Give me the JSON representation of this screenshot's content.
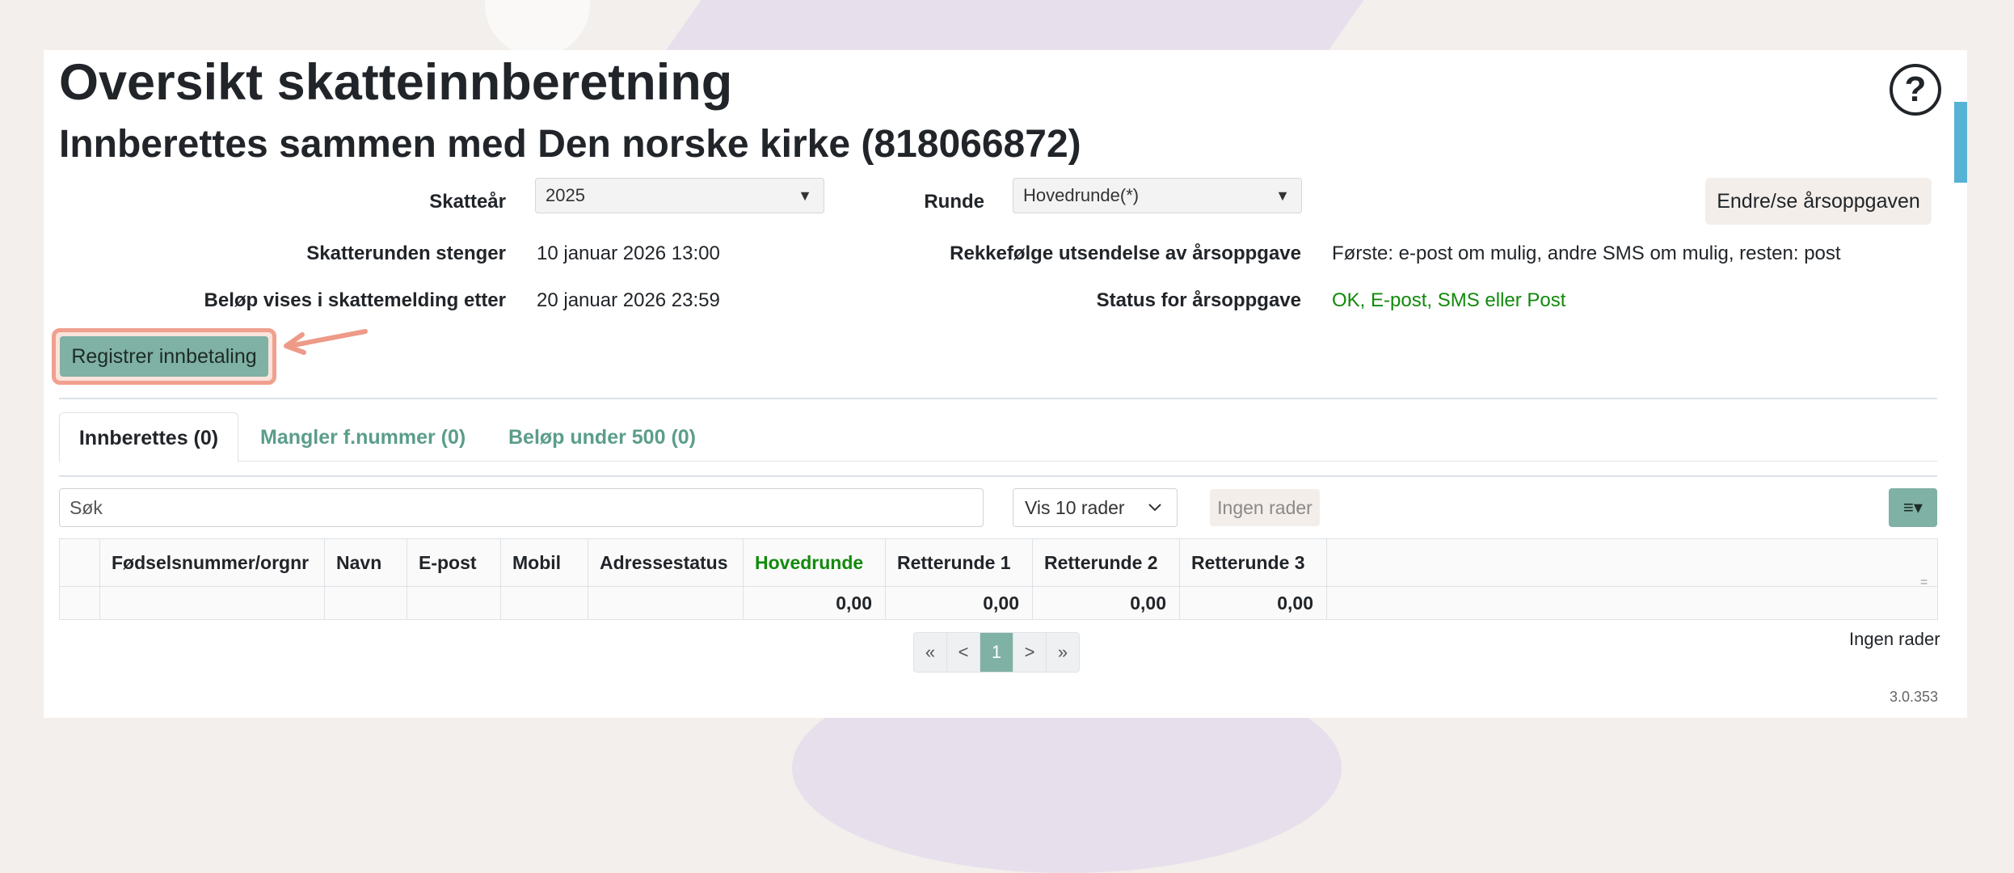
{
  "header": {
    "title": "Oversikt skatteinnberetning",
    "subtitle": "Innberettes sammen med Den norske kirke (818066872)",
    "help_symbol": "?"
  },
  "form": {
    "skatteaar_label": "Skatteår",
    "skatteaar_value": "2025",
    "runde_label": "Runde",
    "runde_value": "Hovedrunde(*)",
    "stenger_label": "Skatterunden stenger",
    "stenger_value": "10 januar 2026 13:00",
    "rekkefolge_label": "Rekkefølge utsendelse av årsoppgave",
    "rekkefolge_value": "Første: e-post om mulig, andre SMS om mulig, resten: post",
    "belop_label": "Beløp vises i skattemelding etter",
    "belop_value": "20 januar 2026 23:59",
    "status_label": "Status for årsoppgave",
    "status_value": "OK, E-post, SMS eller Post",
    "endre_button": "Endre/se årsoppgaven",
    "register_button": "Registrer innbetaling"
  },
  "tabs": [
    {
      "label": "Innberettes (0)",
      "active": true
    },
    {
      "label": "Mangler f.nummer (0)",
      "active": false
    },
    {
      "label": "Beløp under 500 (0)",
      "active": false
    }
  ],
  "toolbar": {
    "search_placeholder": "Søk",
    "rows_select": "Vis 10 rader",
    "no_rows_button": "Ingen rader",
    "menu_symbol": "≡▾"
  },
  "table": {
    "columns": [
      "",
      "Fødselsnummer/orgnr",
      "Navn",
      "E-post",
      "Mobil",
      "Adressestatus",
      "Hovedrunde",
      "Retterunde 1",
      "Retterunde 2",
      "Retterunde 3",
      ""
    ],
    "totals": [
      "",
      "",
      "",
      "",
      "",
      "",
      "0,00",
      "0,00",
      "0,00",
      "0,00",
      ""
    ],
    "filler_symbol": "="
  },
  "pagination": {
    "items": [
      "«",
      "<",
      "1",
      ">",
      "»"
    ],
    "active": "1"
  },
  "footer": {
    "no_rows_text": "Ingen rader",
    "version": "3.0.353"
  },
  "colors": {
    "accent": "#7fb1a4",
    "status_green": "#118a0b",
    "highlight": "#f0a08e"
  }
}
